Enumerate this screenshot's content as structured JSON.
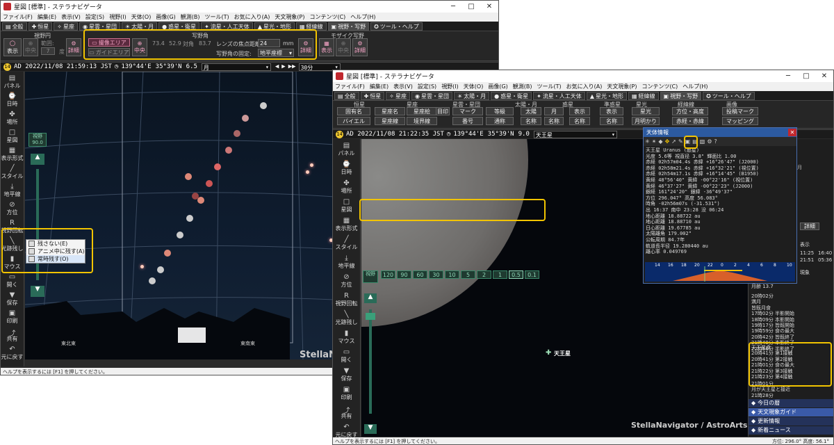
{
  "left_window": {
    "title": "星図 [標準] - ステラナビゲータ",
    "menu": [
      "ファイル(F)",
      "編集(E)",
      "表示(V)",
      "設定(S)",
      "視野(I)",
      "天体(O)",
      "画像(G)",
      "観測(B)",
      "ツール(T)",
      "お気に入り(A)",
      "天文現象(P)",
      "コンテンツ(C)",
      "ヘルプ(H)"
    ],
    "tabs": [
      "全般",
      "恒星",
      "星座",
      "星雲・星団",
      "太陽・月",
      "惑星・衛星",
      "流星・人工天体",
      "星光・地形",
      "経緯線",
      "視野・写野",
      "ツール・ヘルプ"
    ],
    "ribbon": {
      "group_fov": "視野円",
      "group_film": "写野角",
      "group_mosaic": "モザイク写野",
      "btn_show": "表示",
      "btn_center": "中央",
      "label_range": "範囲:",
      "range_value": "7",
      "range_unit": "度",
      "btn_detail": "詳細",
      "btn_film_area": "撮像エリア",
      "btn_guide_area": "ガイドエリア",
      "btn_center2": "中央",
      "film_w": "73.4",
      "film_h": "52.9",
      "film_diag_label": "対角",
      "film_diag": "83.7",
      "lens_label": "レンズの焦点距離:",
      "lens_value": "24",
      "lens_unit": "mm",
      "fix_label": "写野角の固定:",
      "fix_value": "地平座標",
      "btn_detail2": "詳細",
      "btn_show3": "表示",
      "btn_center3": "中央",
      "btn_detail3": "詳細"
    },
    "status": {
      "badge": "14",
      "date": "AD 2022/11/08 21:59:13 JST",
      "lon": "139°44'E",
      "lat": "35°39'N",
      "fov": "6.5",
      "target": "月",
      "interval": "30分"
    },
    "sidebar": [
      "パネル",
      "日時",
      "場所",
      "星図",
      "表示形式",
      "スタイル",
      "地平線",
      "方位",
      "視野回転",
      "光跡残し",
      "マウス",
      "開く",
      "保存",
      "印刷",
      "共有",
      "元に戻す"
    ],
    "fov_label": "視野",
    "fov_value": "90.0",
    "context_menu": [
      "残さない(E)",
      "アニメ中に残す(A)",
      "常時残す(O)"
    ],
    "horizon_labels": [
      "東北東",
      "東南東"
    ],
    "watermark": "StellaNavi",
    "help": "ヘルプを表示するには [F1] を押してください。"
  },
  "right_window": {
    "title": "星図 [標準] - ステラナビゲータ",
    "menu": [
      "ファイル(F)",
      "編集(E)",
      "表示(V)",
      "設定(S)",
      "視野(I)",
      "天体(O)",
      "画像(G)",
      "観測(B)",
      "ツール(T)",
      "お気に入り(A)",
      "天文現象(P)",
      "コンテンツ(C)",
      "ヘルプ(H)"
    ],
    "tabs": [
      "全般",
      "恒星",
      "星座",
      "星雲・星団",
      "太陽・月",
      "惑星・衛星",
      "流星・人工天体",
      "星光・地形",
      "経緯線",
      "視野・写野",
      "ツール・ヘルプ"
    ],
    "ribbon": {
      "g_star": "恒星",
      "g_const": "星座",
      "g_neb": "星雲・星団",
      "g_sun": "太陽・月",
      "g_planet": "惑星",
      "g_dwarf": "準惑星",
      "g_light": "星光",
      "g_grid": "経緯線",
      "g_image": "画像",
      "b1": "固有名",
      "b2": "バイエル",
      "b3": "星座名",
      "b4": "星座線",
      "b5": "星座絵",
      "b6": "境界線",
      "b7": "目印",
      "b8": "マーク",
      "b9": "番号",
      "b10": "等級",
      "b11": "通称",
      "b12": "太陽",
      "b13": "月",
      "b14": "名称",
      "b15": "名称",
      "b16": "表示",
      "b17": "名称",
      "b18": "表示",
      "b19": "名称",
      "b20": "星光",
      "b21": "月明かり",
      "b22": "方位・高度",
      "b23": "赤経・赤緯",
      "b24": "投稿マーク",
      "b25": "マッピング"
    },
    "status": {
      "badge": "14",
      "date": "AD 2022/11/08 21:22:35 JST",
      "lon": "139°44'E",
      "lat": "35°39'N",
      "fov": "9.0",
      "target": "天王星"
    },
    "sidebar": [
      "パネル",
      "日時",
      "場所",
      "星図",
      "表示形式",
      "スタイル",
      "地平線",
      "方位",
      "視野回転",
      "光跡残し",
      "マウス",
      "開く",
      "保存",
      "印刷",
      "共有",
      "元に戻す"
    ],
    "fov_label": "視野",
    "fov_buttons": [
      "120",
      "90",
      "60",
      "30",
      "10",
      "5",
      "2",
      "1",
      "0.5",
      "0.1"
    ],
    "object_label": "天王星",
    "watermark": "StellaNavigator / AstroArts",
    "help": "ヘルプを表示するには [F1] を押してください。",
    "bottom_status": "方位: 296.0°  高度: 56.1°"
  },
  "info_panel": {
    "title": "天体情報",
    "lines": [
      "天王星 Uranus (惑星)",
      "光度  5.6等  視直径 3.8\"  輝面比 1.00",
      "赤経 02h57m04.4s  赤緯 +16°26'47\" (J2000)",
      "赤経 02h58m21.4s  赤緯 +16°32'21\" (視位置)",
      "赤経 02h54m17.1s  赤緯 +16°14'45\" (B1950)",
      "黄経  48°56'40\"   黄緯 -00°22'16\" (視位置)",
      "黄経  46°37'27\"   黄緯 -00°22'23\" (J2000)",
      "銀経 161°24'20\"   銀緯 -36°49'37\"",
      "方位 296.047°      高度  56.083°",
      "時角 -02h56m07s (-31.531°)",
      "出 16:37  南中 23:28  没 06:24",
      "地心距離 18.88722 au",
      "地心距離 18.88710 au",
      "日心距離 19.67785 au",
      "太陽離角 179.002°",
      "公転周期 84.7年",
      "軌道長半径 19.280440 au",
      "離心率 0.049769"
    ],
    "scale_ticks": [
      "14",
      "16",
      "18",
      "20",
      "22",
      "0",
      "2",
      "4",
      "6",
      "8",
      "10"
    ]
  },
  "right_panel": {
    "calendar_header": "月",
    "detail_btn": "詳細",
    "display_label": "表示",
    "times": [
      "11:25",
      "16:40",
      "21:51",
      "05:36"
    ],
    "sec_label": "現象",
    "age_label": "月齢 13.7",
    "events": [
      "20時02分",
      "満月",
      "皆既月食",
      "17時02分 半影開始",
      "18時09分 本影開始",
      "19時17分 皆既開始",
      "19時59分 食の最大",
      "20時42分 皆既終了",
      "21時49分 本影終了",
      "22時56分 半影終了"
    ],
    "uranus_events": [
      "天王星食",
      "20時41分 第1接触",
      "20時41分 第2接触",
      "21時01分 食の最大",
      "21時22分 第3接触",
      "21時23分 第4接触"
    ],
    "after_events": [
      "21時01分",
      "月が天王星と接近",
      "21時28分"
    ],
    "links": [
      "今日の暦",
      "天文現象ガイド",
      "更新情報",
      "新着ニュース"
    ]
  }
}
